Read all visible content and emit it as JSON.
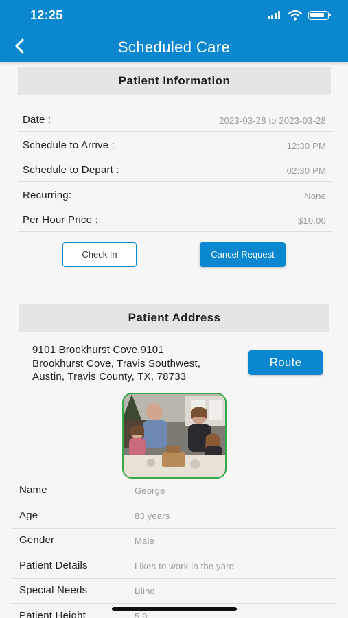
{
  "status_bar": {
    "time": "12:25"
  },
  "navbar": {
    "title": "Scheduled Care",
    "back_icon": "chevron-left-icon"
  },
  "patient_information": {
    "header": "Patient Information",
    "rows": [
      {
        "label": "Date :",
        "value": "2023-03-28 to 2023-03-28"
      },
      {
        "label": "Schedule to Arrive :",
        "value": "12:30 PM"
      },
      {
        "label": "Schedule to Depart :",
        "value": "02:30 PM"
      },
      {
        "label": "Recurring:",
        "value": "None"
      },
      {
        "label": "Per Hour Price :",
        "value": "$10.00"
      }
    ],
    "check_in_label": "Check In",
    "cancel_label": "Cancel Request"
  },
  "patient_address": {
    "header": "Patient Address",
    "lines": [
      "9101 Brookhurst Cove,9101",
      "Brookhurst Cove, Travis Southwest,",
      "Austin, Travis County, TX, 78733"
    ],
    "route_label": "Route"
  },
  "patient_details": [
    {
      "label": "Name",
      "value": "George"
    },
    {
      "label": "Age",
      "value": "83 years"
    },
    {
      "label": "Gender",
      "value": "Male"
    },
    {
      "label": "Patient Details",
      "value": "Likes to work in the yard"
    },
    {
      "label": "Special Needs",
      "value": "Blind"
    },
    {
      "label": "Patient Height",
      "value": "5.9"
    }
  ],
  "colors": {
    "brand": "#0b87cf",
    "photo_border": "#37a845"
  }
}
